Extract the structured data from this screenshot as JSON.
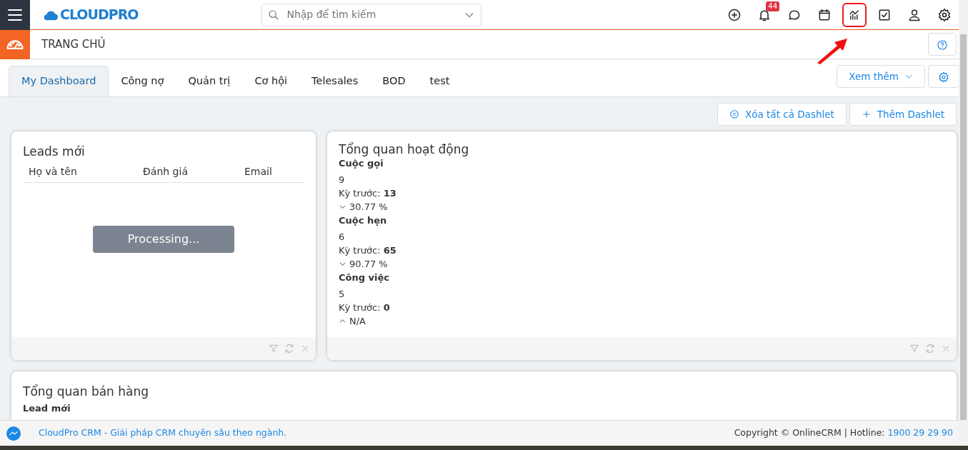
{
  "topbar": {
    "logo": "CLOUDPRO",
    "search": {
      "placeholder": "Nhập để tìm kiếm"
    },
    "notification_count": "44",
    "icons": [
      {
        "kind": "add",
        "highlighted": false
      },
      {
        "kind": "bell",
        "highlighted": false
      },
      {
        "kind": "chat",
        "highlighted": false
      },
      {
        "kind": "calendar",
        "highlighted": false
      },
      {
        "kind": "chart",
        "highlighted": true
      },
      {
        "kind": "task",
        "highlighted": false
      },
      {
        "kind": "user",
        "highlighted": false
      },
      {
        "kind": "settings",
        "highlighted": false
      }
    ]
  },
  "page_header": {
    "title": "TRANG CHỦ"
  },
  "tabs": [
    {
      "label": "My Dashboard",
      "selected": true
    },
    {
      "label": "Công nợ",
      "selected": false
    },
    {
      "label": "Quản trị",
      "selected": false
    },
    {
      "label": "Cơ hội",
      "selected": false
    },
    {
      "label": "Telesales",
      "selected": false
    },
    {
      "label": "BOD",
      "selected": false
    },
    {
      "label": "test",
      "selected": false
    }
  ],
  "more_button": "Xem thêm",
  "actions": [
    {
      "kind": "remove",
      "label": "Xóa tất cả Dashlet"
    },
    {
      "kind": "add",
      "label": "Thêm Dashlet"
    }
  ],
  "leads_dashlet": {
    "title": "Leads mới",
    "columns": [
      "Họ và tên",
      "Đánh giá",
      "Email"
    ],
    "loading": "Processing..."
  },
  "activity_dashlet": {
    "title": "Tổng quan hoạt động",
    "groups": [
      {
        "name": "Cuộc gọi",
        "value": "9",
        "previous": "Kỳ trước: **13**",
        "kind": "down",
        "change": "30.77 %"
      },
      {
        "name": "Cuộc hẹn",
        "value": "6",
        "previous": "Kỳ trước: **65**",
        "kind": "down",
        "change": "90.77 %"
      },
      {
        "name": "Công việc",
        "value": "5",
        "previous": "Kỳ trước: **0**",
        "kind": "up",
        "change": "N/A"
      }
    ]
  },
  "sales_dashlet": {
    "title": "Tổng quan bán hàng",
    "subtitle": "Lead mới"
  },
  "footer": {
    "link": "CloudPro CRM - Giải pháp CRM chuyên sâu theo ngành.",
    "copyright": "Copyright © OnlineCRM | Hotline:",
    "hotline": "1900 29 29 90"
  }
}
